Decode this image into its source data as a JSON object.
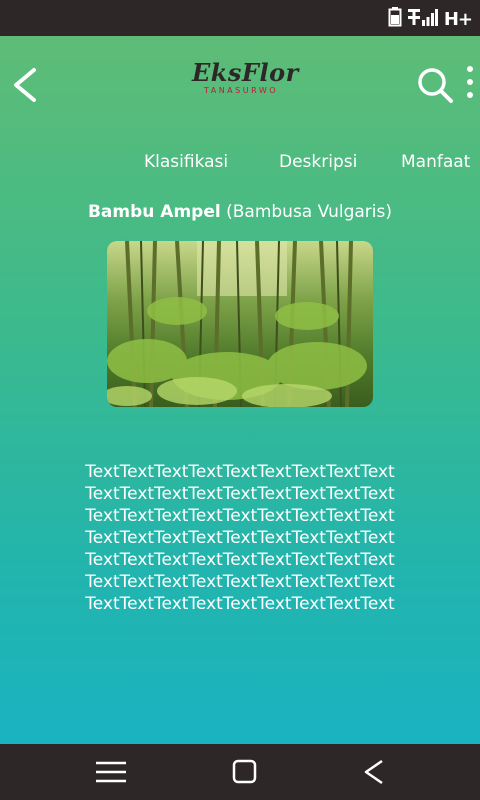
{
  "status_bar": {
    "battery_icon": "battery-icon",
    "signal_icon": "signal-icon",
    "network": "H+"
  },
  "header": {
    "back_icon": "back-arrow-icon",
    "logo_text": "EksFlor",
    "logo_subtext": "TANASURWO",
    "search_icon": "search-icon",
    "menu_icon": "overflow-menu-icon"
  },
  "tabs": [
    {
      "label": "Klasifikasi"
    },
    {
      "label": "Deskripsi"
    },
    {
      "label": "Manfaat"
    }
  ],
  "plant": {
    "common_name": "Bambu Ampel",
    "scientific_name": "(Bambusa Vulgaris)"
  },
  "description": {
    "lines": [
      "TextTextTextTextTextTextTextTextText",
      "TextTextTextTextTextTextTextTextText",
      "TextTextTextTextTextTextTextTextText",
      "TextTextTextTextTextTextTextTextText",
      "TextTextTextTextTextTextTextTextText",
      "TextTextTextTextTextTextTextTextText",
      "TextTextTextTextTextTextTextTextText"
    ]
  },
  "nav_bar": {
    "menu_icon": "hamburger-menu-icon",
    "home_icon": "home-icon",
    "back_icon": "back-icon"
  },
  "colors": {
    "gradient_top": "#5ebc76",
    "gradient_bottom": "#1ab3c1",
    "bar_background": "#2d2827",
    "logo_accent": "#c0183b"
  }
}
